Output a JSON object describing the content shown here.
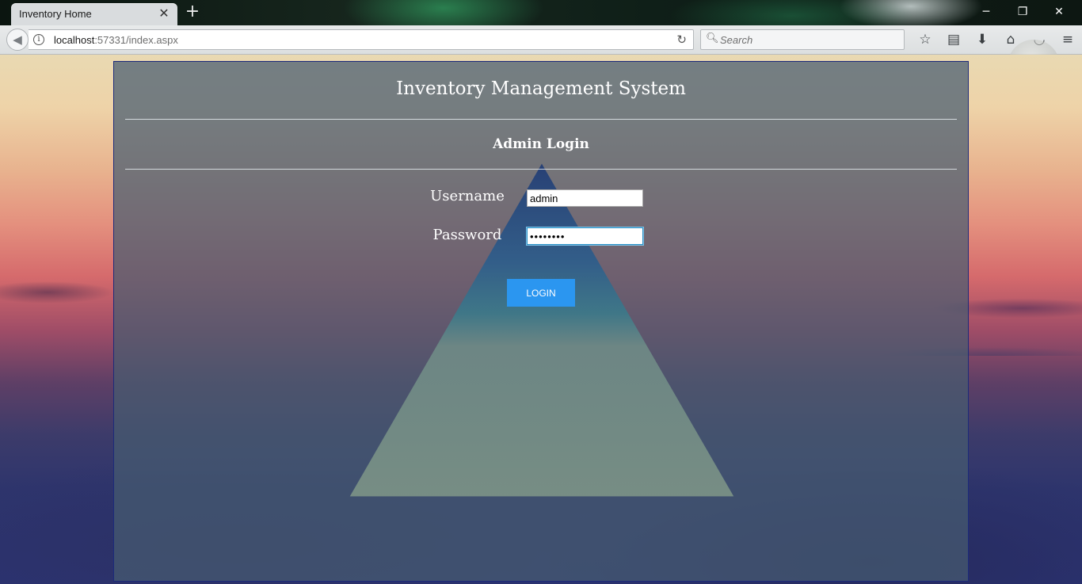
{
  "browser": {
    "tab_title": "Inventory Home",
    "tab_close_glyph": "✕",
    "new_tab_glyph": "+",
    "url_host": "localhost",
    "url_rest": ":57331/index.aspx",
    "search_placeholder": "Search",
    "window_controls": [
      "─",
      "❐",
      "✕"
    ],
    "toolbar_icons": [
      {
        "name": "bookmark-star-icon",
        "glyph": "☆"
      },
      {
        "name": "reader-list-icon",
        "glyph": "▤"
      },
      {
        "name": "download-icon",
        "glyph": "⬇"
      },
      {
        "name": "home-icon",
        "glyph": "⌂"
      },
      {
        "name": "pocket-icon",
        "glyph": "◡"
      },
      {
        "name": "menu-icon",
        "glyph": "≡"
      }
    ]
  },
  "page": {
    "title": "Inventory Management System",
    "subtitle": "Admin Login",
    "username_label": "Username",
    "username_value": "admin",
    "password_label": "Password",
    "password_value": "••••••••",
    "login_label": "LOGIN"
  },
  "colors": {
    "login_button": "#2b96f0",
    "panel_border": "#1c2a7a"
  }
}
